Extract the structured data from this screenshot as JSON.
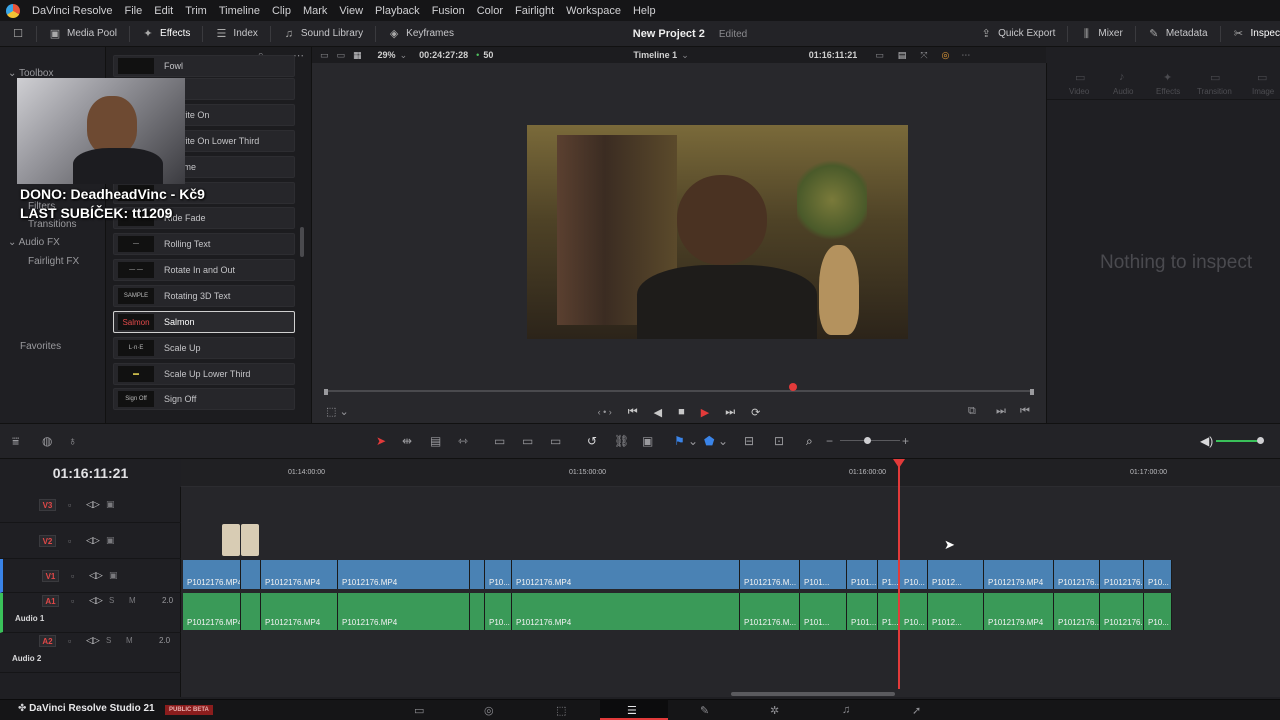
{
  "menubar": {
    "app": "DaVinci Resolve",
    "items": [
      "File",
      "Edit",
      "Trim",
      "Timeline",
      "Clip",
      "Mark",
      "View",
      "Playback",
      "Fusion",
      "Color",
      "Fairlight",
      "Workspace",
      "Help"
    ]
  },
  "toolbar": {
    "media_pool": "Media Pool",
    "effects": "Effects",
    "index": "Index",
    "sound_library": "Sound Library",
    "keyframes": "Keyframes",
    "project_name": "New Project 2",
    "project_status": "Edited",
    "quick_export": "Quick Export",
    "mixer": "Mixer",
    "metadata": "Metadata",
    "inspector": "Inspec"
  },
  "toolbox": {
    "toolbox": "Toolbox",
    "fx_label": "Filters",
    "transitions": "Transitions",
    "audio_fx": "Audio FX",
    "fairlight_fx": "Fairlight FX",
    "favorites": "Favorites"
  },
  "effects": [
    {
      "label": "Fowl",
      "thumb": ""
    },
    {
      "label": "ow",
      "thumb": ""
    },
    {
      "label": "m Write On",
      "thumb": ""
    },
    {
      "label": "m Write On Lower Third",
      "thumb": ""
    },
    {
      "label": "Chrome",
      "thumb": ""
    },
    {
      "label": "",
      "thumb": ""
    },
    {
      "label": "Ride Fade",
      "thumb": ""
    },
    {
      "label": "Rolling Text",
      "thumb": "—"
    },
    {
      "label": "Rotate In and Out",
      "thumb": "— —"
    },
    {
      "label": "Rotating 3D Text",
      "thumb": "SAMPLE"
    },
    {
      "label": "Salmon",
      "thumb": "Salmon",
      "selected": true
    },
    {
      "label": "Scale Up",
      "thumb": "L·n·E"
    },
    {
      "label": "Scale Up Lower Third",
      "thumb": "▬"
    },
    {
      "label": "Sign Off",
      "thumb": "Sign Off"
    }
  ],
  "viewer": {
    "zoom": "29%",
    "source_tc": "00:24:27:28",
    "fps": "50",
    "timeline": "Timeline 1",
    "record_tc": "01:16:11:21"
  },
  "inspector": {
    "tabs": [
      "Video",
      "Audio",
      "Effects",
      "Transition",
      "Image"
    ],
    "empty": "Nothing to inspect"
  },
  "overlay": {
    "line1": "DONO: DeadheadVinc - Kč9",
    "line2": "LAST SUBÍČEK: tt1209"
  },
  "timeline": {
    "timecode": "01:16:11:21",
    "ruler": [
      "01:14:00:00",
      "01:15:00:00",
      "01:16:00:00",
      "01:17:00:00"
    ],
    "tracks": [
      {
        "id": "V3"
      },
      {
        "id": "V2"
      },
      {
        "id": "V1"
      },
      {
        "id": "A1",
        "name": "Audio 1",
        "level": "2.0"
      },
      {
        "id": "A2",
        "name": "Audio 2",
        "level": "2.0"
      }
    ],
    "video_clips": [
      "P1012176.MP4",
      "P1012176.MP4",
      "P1012176.MP4",
      "P10...",
      "P1012176.MP4",
      "P1012176.M...",
      "P101...",
      "P101...",
      "P1...",
      "P10...",
      "P1012...",
      "P1012179.MP4",
      "P1012176...",
      "P1012176...",
      "P10..."
    ],
    "audio_clips": [
      "P1012176.MP4",
      "P1012176.MP4",
      "P1012176.MP4",
      "P10...",
      "P1012176.MP4",
      "P1012176.M...",
      "P101...",
      "P101...",
      "P1...",
      "P10...",
      "P1012...",
      "P1012179.MP4",
      "P1012176...",
      "P1012176...",
      "P10..."
    ]
  },
  "pagebar": {
    "brand": "DaVinci Resolve Studio 21",
    "beta": "PUBLIC BETA"
  },
  "colors": {
    "accent_red": "#e23a3a",
    "video_clip": "#4a82b4",
    "audio_clip": "#3a9a58"
  }
}
